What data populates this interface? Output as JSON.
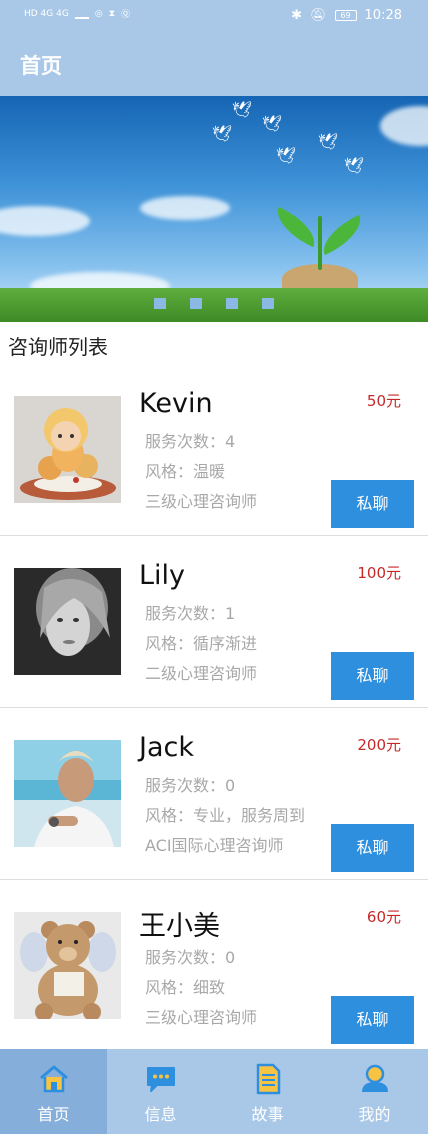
{
  "status_bar": {
    "left_text": "HD 4G 4G",
    "battery": "69",
    "time": "10:28"
  },
  "header": {
    "title": "首页"
  },
  "banner": {
    "slide_count": 4,
    "active_index": 0
  },
  "section": {
    "title": "咨询师列表"
  },
  "counselors": [
    {
      "name": "Kevin",
      "price": "50元",
      "service_count": "服务次数：4",
      "style": "风格：温暖",
      "level": "三级心理咨询师",
      "chat_label": "私聊"
    },
    {
      "name": "Lily",
      "price": "100元",
      "service_count": "服务次数：1",
      "style": "风格：循序渐进",
      "level": "二级心理咨询师",
      "chat_label": "私聊"
    },
    {
      "name": "Jack",
      "price": "200元",
      "service_count": "服务次数：0",
      "style": "风格：专业，服务周到",
      "level": "ACI国际心理咨询师",
      "chat_label": "私聊"
    },
    {
      "name": "王小美",
      "price": "60元",
      "service_count": "服务次数：0",
      "style": "风格：细致",
      "level": "三级心理咨询师",
      "chat_label": "私聊"
    }
  ],
  "bottom_nav": [
    {
      "label": "首页",
      "icon": "home-icon",
      "active": true
    },
    {
      "label": "信息",
      "icon": "message-icon",
      "active": false
    },
    {
      "label": "故事",
      "icon": "document-icon",
      "active": false
    },
    {
      "label": "我的",
      "icon": "user-icon",
      "active": false
    }
  ],
  "colors": {
    "header_bg": "#a9c8e8",
    "button_bg": "#2f8fdf",
    "price": "#c62828",
    "nav_active": "#86aedb"
  }
}
